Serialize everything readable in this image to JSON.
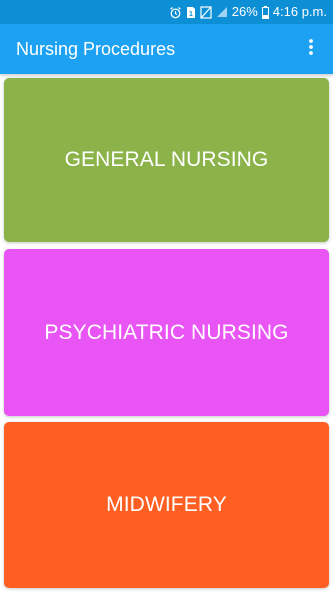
{
  "status_bar": {
    "battery_percent": "26%",
    "time": "4:16 p.m.",
    "icons": [
      "alarm-icon",
      "sim-1-icon",
      "no-sim-icon",
      "signal-icon",
      "battery-icon"
    ]
  },
  "app_bar": {
    "title": "Nursing Procedures",
    "overflow_icon": "more-vert-icon"
  },
  "categories": [
    {
      "label": "GENERAL NURSING",
      "color": "#8bb34a"
    },
    {
      "label": "PSYCHIATRIC NURSING",
      "color": "#e955f5"
    },
    {
      "label": "MIDWIFERY",
      "color": "#ff5f22"
    }
  ],
  "colors": {
    "status_bar": "#0d8fd6",
    "app_bar": "#1da1f2",
    "text_on_color": "#ffffff"
  }
}
